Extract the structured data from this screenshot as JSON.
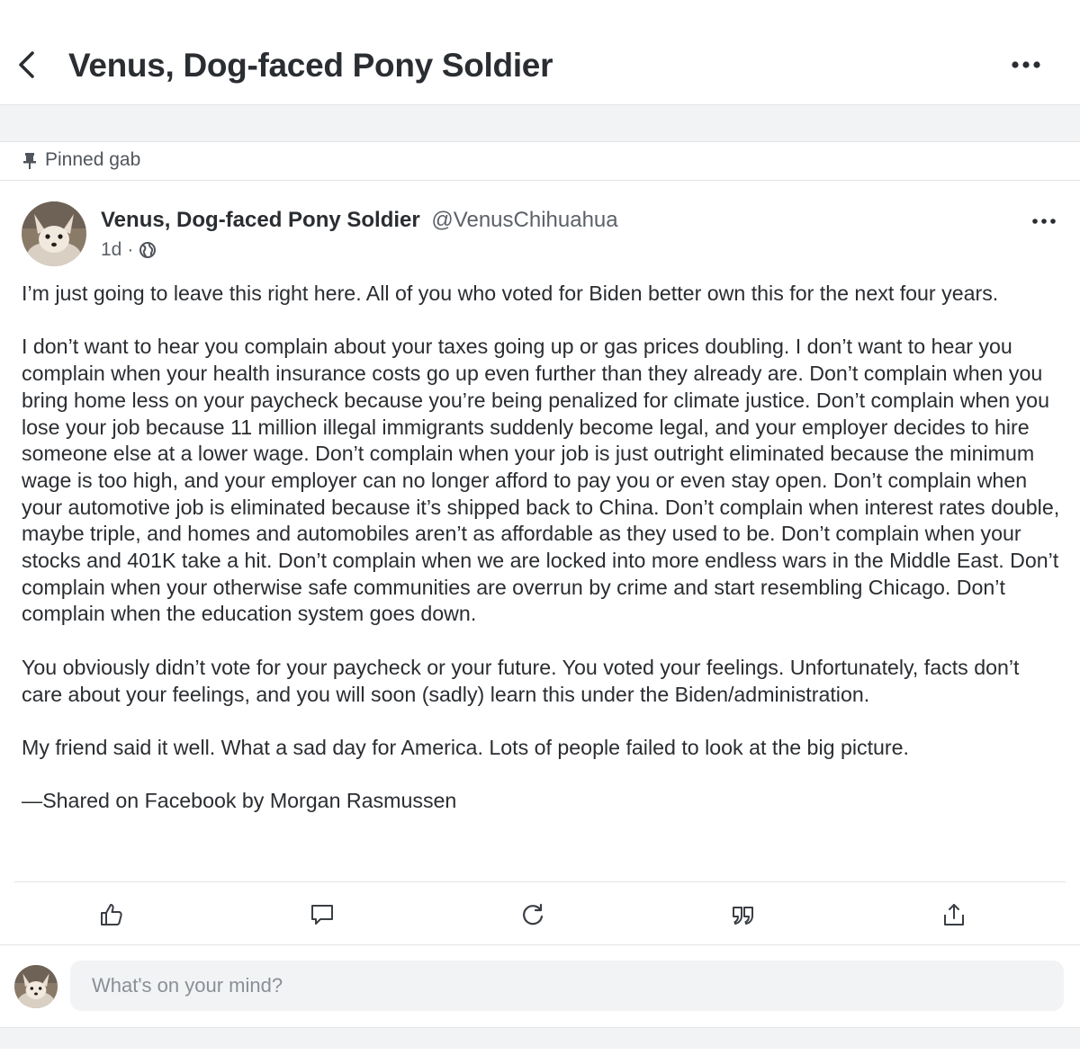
{
  "header": {
    "title": "Venus, Dog-faced Pony Soldier",
    "back_icon": "chevron-left-icon",
    "more_icon": "more-horizontal-icon"
  },
  "pinned": {
    "label": "Pinned gab",
    "icon": "pin-icon"
  },
  "post": {
    "author_name": "Venus, Dog-faced Pony Soldier",
    "author_handle": "@VenusChihuahua",
    "time": "1d",
    "separator": "·",
    "visibility_icon": "globe-icon",
    "paragraphs": [
      "I’m just going to leave this right here. All of you who voted for Biden better own this for the next four years.",
      "I don’t want to hear you complain about your taxes going up or gas prices doubling. I don’t want to hear you complain when your health insurance costs go up even further than they already are. Don’t complain when you bring home less on your paycheck because you’re being penalized for climate justice. Don’t complain when you lose your job because 11 million illegal immigrants suddenly become legal, and your employer decides to hire someone else at a lower wage. Don’t complain when your job is just outright eliminated because the minimum wage is too high, and your employer can no longer afford to pay you or even stay open. Don’t complain when your automotive job is eliminated because it’s shipped back to China. Don’t complain when interest rates double, maybe triple, and homes and automobiles aren’t as affordable as they used to be. Don’t complain when your stocks and 401K take a hit. Don’t complain when we are locked into more endless wars in the Middle East. Don’t complain when your otherwise safe communities are overrun by crime and start resembling Chicago. Don’t complain when the education system goes down.",
      "You obviously didn’t vote for your paycheck or your future. You voted your feelings. Unfortunately, facts don’t care about your feelings, and you will soon (sadly) learn this under the Biden/administration.",
      "My friend said it well. What a sad day for America. Lots of people failed to look at the big picture.",
      "—Shared on Facebook by Morgan Rasmussen"
    ],
    "actions": [
      "like-icon",
      "comment-icon",
      "repost-icon",
      "quote-icon",
      "share-icon"
    ]
  },
  "compose": {
    "placeholder": "What's on your mind?"
  },
  "colors": {
    "background": "#ffffff",
    "separator": "#f2f3f5",
    "text": "#2a2d31",
    "muted": "#5c6168"
  }
}
